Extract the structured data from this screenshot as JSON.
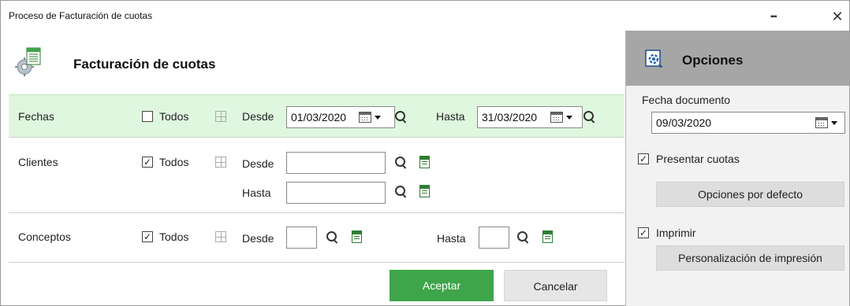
{
  "window": {
    "title": "Proceso de Facturación de cuotas",
    "more_label": "▪▪▪",
    "close_label": "✕"
  },
  "header": {
    "title": "Facturación de cuotas",
    "icon": "document-gear-icon"
  },
  "fechas": {
    "label": "Fechas",
    "todos_label": "Todos",
    "todos_checked": false,
    "desde_label": "Desde",
    "desde_value": "01/03/2020",
    "hasta_label": "Hasta",
    "hasta_value": "31/03/2020"
  },
  "clientes": {
    "label": "Clientes",
    "todos_label": "Todos",
    "todos_checked": true,
    "desde_label": "Desde",
    "desde_value": "",
    "hasta_label": "Hasta",
    "hasta_value": ""
  },
  "conceptos": {
    "label": "Conceptos",
    "todos_label": "Todos",
    "todos_checked": true,
    "desde_label": "Desde",
    "desde_value": "",
    "hasta_label": "Hasta",
    "hasta_value": ""
  },
  "actions": {
    "accept_label": "Aceptar",
    "cancel_label": "Cancelar"
  },
  "options": {
    "title": "Opciones",
    "fecha_documento_label": "Fecha documento",
    "fecha_documento_value": "09/03/2020",
    "presentar_cuotas_label": "Presentar cuotas",
    "presentar_cuotas_checked": true,
    "opciones_defecto_label": "Opciones por defecto",
    "imprimir_label": "Imprimir",
    "imprimir_checked": true,
    "personalizacion_label": "Personalización de impresión"
  },
  "colors": {
    "accent_green": "#3ea54a",
    "row_highlight": "#dff7df",
    "panel_header": "#a6a6a6"
  }
}
